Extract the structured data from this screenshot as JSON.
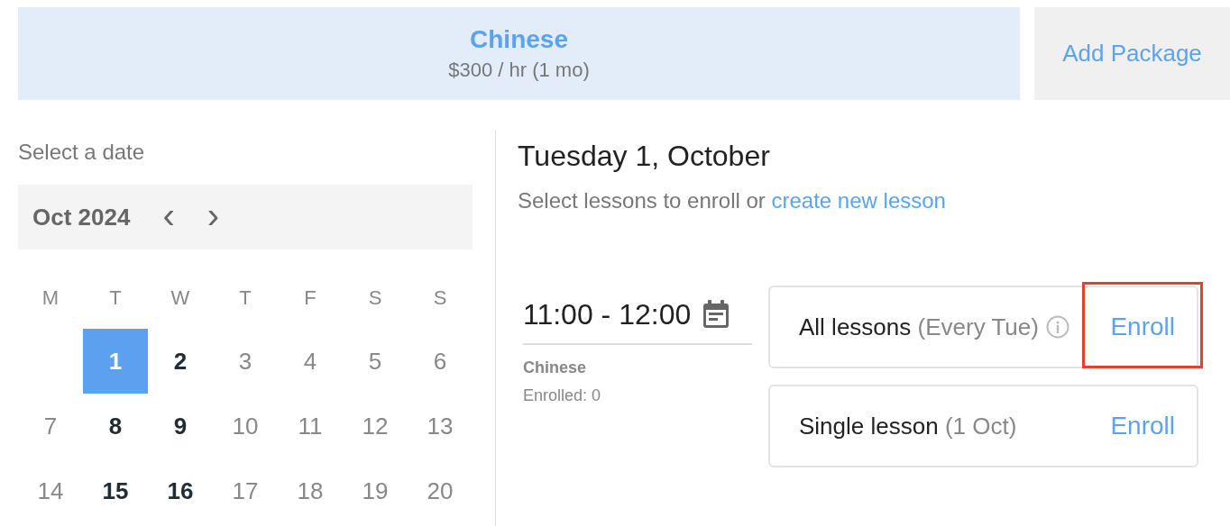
{
  "package": {
    "name": "Chinese",
    "price": "$300 / hr (1 mo)"
  },
  "add_package": "Add Package",
  "calendar": {
    "label": "Select a date",
    "month": "Oct 2024",
    "prev": "‹",
    "next": "›",
    "weekdays": [
      "M",
      "T",
      "W",
      "T",
      "F",
      "S",
      "S"
    ],
    "weeks": [
      {
        "partial": true,
        "days": [
          {
            "day": "1",
            "selected": true,
            "has_lessons": true
          },
          {
            "day": "2",
            "selected": false,
            "has_lessons": true
          },
          {
            "day": "3",
            "selected": false,
            "has_lessons": false
          },
          {
            "day": "4",
            "selected": false,
            "has_lessons": false
          },
          {
            "day": "5",
            "selected": false,
            "has_lessons": false
          },
          {
            "day": "6",
            "selected": false,
            "has_lessons": false
          }
        ]
      },
      {
        "partial": false,
        "days": [
          {
            "day": "7",
            "selected": false,
            "has_lessons": false
          },
          {
            "day": "8",
            "selected": false,
            "has_lessons": true
          },
          {
            "day": "9",
            "selected": false,
            "has_lessons": true
          },
          {
            "day": "10",
            "selected": false,
            "has_lessons": false
          },
          {
            "day": "11",
            "selected": false,
            "has_lessons": false
          },
          {
            "day": "12",
            "selected": false,
            "has_lessons": false
          },
          {
            "day": "13",
            "selected": false,
            "has_lessons": false
          }
        ]
      },
      {
        "partial": false,
        "days": [
          {
            "day": "14",
            "selected": false,
            "has_lessons": false
          },
          {
            "day": "15",
            "selected": false,
            "has_lessons": true
          },
          {
            "day": "16",
            "selected": false,
            "has_lessons": true
          },
          {
            "day": "17",
            "selected": false,
            "has_lessons": false
          },
          {
            "day": "18",
            "selected": false,
            "has_lessons": false
          },
          {
            "day": "19",
            "selected": false,
            "has_lessons": false
          },
          {
            "day": "20",
            "selected": false,
            "has_lessons": false
          }
        ]
      }
    ]
  },
  "day_view": {
    "title": "Tuesday 1, October",
    "subtitle": "Select lessons to enroll or",
    "create_link": "create new lesson",
    "lesson": {
      "time": "11:00 - 12:00",
      "course": "Chinese",
      "enrolled": "Enrolled: 0",
      "options": [
        {
          "label": "All lessons",
          "detail": "(Every Tue)",
          "info": true,
          "action": "Enroll",
          "highlighted": true
        },
        {
          "label": "Single lesson",
          "detail": "(1 Oct)",
          "info": false,
          "action": "Enroll",
          "highlighted": false
        }
      ]
    }
  }
}
